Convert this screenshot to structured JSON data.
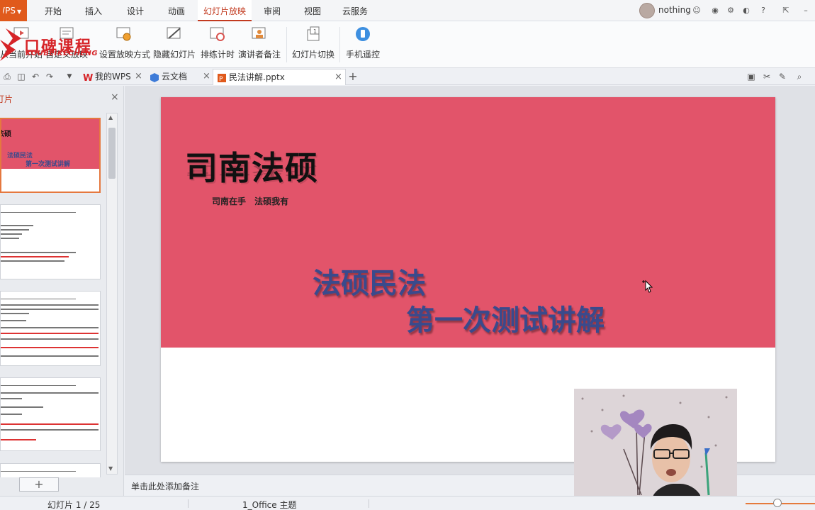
{
  "menu": {
    "app_button": "WPS",
    "tabs": [
      "开始",
      "插入",
      "设计",
      "动画",
      "幻灯片放映",
      "审阅",
      "视图",
      "云服务"
    ],
    "active_tab": "幻灯片放映",
    "user_name": "nothing",
    "help_label": "?"
  },
  "ribbon": {
    "buttons": [
      {
        "label": "从当前开始",
        "icon": "play-from-current-icon"
      },
      {
        "label": "自定义放映",
        "icon": "custom-show-icon"
      },
      {
        "label": "设置放映方式",
        "icon": "setup-show-icon"
      },
      {
        "label": "隐藏幻灯片",
        "icon": "hide-slide-icon"
      },
      {
        "label": "排练计时",
        "icon": "rehearse-timing-icon"
      },
      {
        "label": "演讲者备注",
        "icon": "speaker-notes-icon"
      },
      {
        "label": "幻灯片切换",
        "icon": "slide-transition-icon"
      },
      {
        "label": "手机遥控",
        "icon": "phone-remote-icon"
      }
    ]
  },
  "logo": {
    "text": "口碑课程",
    "subtext": "KOUBEIKECHENG"
  },
  "tabs": {
    "items": [
      {
        "label": "我的WPS"
      },
      {
        "label": "云文档"
      },
      {
        "label": "民法讲解.pptx"
      }
    ],
    "active": "民法讲解.pptx"
  },
  "left_panel": {
    "title": "幻灯片",
    "thumb1": {
      "title": "司南法硕",
      "sub1": "法硕民法",
      "sub2": "第一次测试讲解"
    }
  },
  "slide": {
    "title": "司南法硕",
    "tagline": "司南在手 法硕我有",
    "subtitle_line1": "法硕民法",
    "subtitle_line2": "第一次测试讲解",
    "band_color": "#e2546a",
    "subtitle_color": "#3a4a8c"
  },
  "notes": {
    "placeholder": "单击此处添加备注"
  },
  "status": {
    "slide_indicator": "幻灯片 1 / 25",
    "theme": "1_Office 主题"
  }
}
